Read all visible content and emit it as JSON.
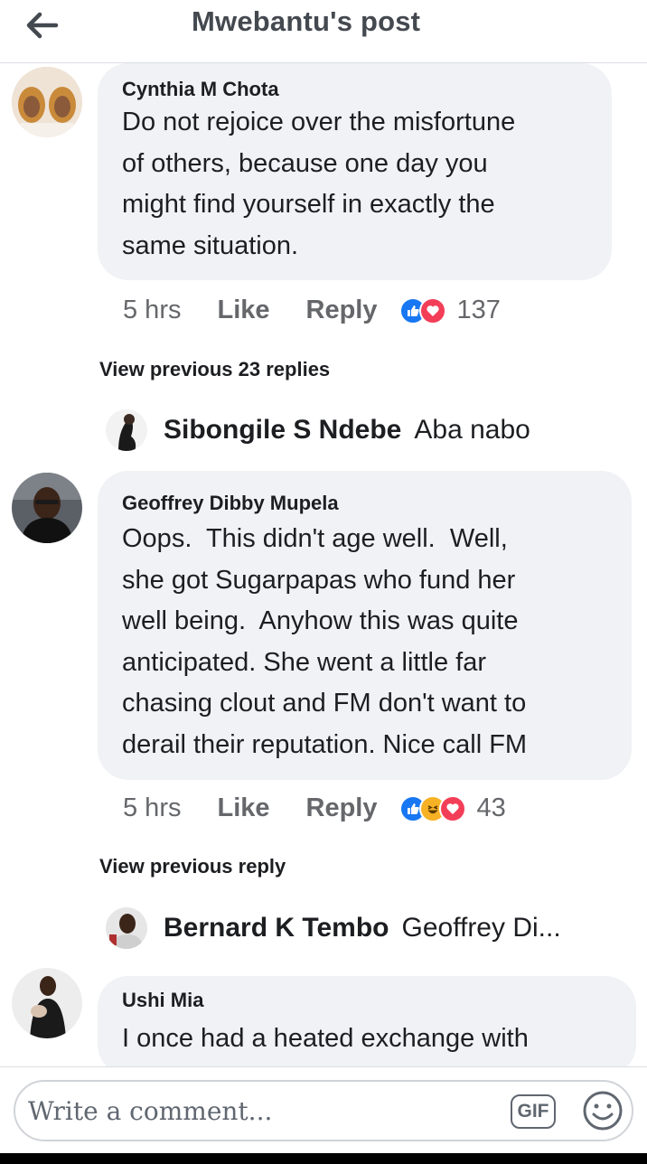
{
  "header": {
    "title": "Mwebantu's post"
  },
  "comments": [
    {
      "author": "Cynthia M Chota",
      "lines": [
        "Do not rejoice over the misfortune",
        "of others, because one day you",
        "might find yourself in exactly the",
        "same situation."
      ],
      "time": "5 hrs",
      "like": "Like",
      "reply": "Reply",
      "reaction_count": "137",
      "reactions": [
        "like",
        "love"
      ]
    },
    {
      "author": "Geoffrey Dibby Mupela",
      "lines": [
        "Oops.  This didn't age well.  Well,",
        "she got Sugarpapas who fund her",
        "well being.  Anyhow this was quite",
        "anticipated. She went a little far",
        "chasing clout and FM don't want to",
        "derail their reputation. Nice call FM"
      ],
      "time": "5 hrs",
      "like": "Like",
      "reply": "Reply",
      "reaction_count": "43",
      "reactions": [
        "like",
        "haha",
        "love"
      ]
    },
    {
      "author": "Ushi Mia",
      "lines": [
        "I once had a heated exchange with"
      ]
    }
  ],
  "view_previous_1": "View previous 23 replies",
  "reply_1": {
    "name": "Sibongile S Ndebe",
    "text": "Aba nabo"
  },
  "view_previous_2": "View previous reply",
  "reply_2": {
    "name": "Bernard K Tembo",
    "text": "Geoffrey Di..."
  },
  "composer": {
    "placeholder": "Write a comment...",
    "gif_label": "GIF"
  },
  "colors": {
    "like_blue": "#1877f2",
    "love_red": "#f33e58",
    "haha_yellow": "#f7b125",
    "bubble_gray": "#f0f2f5"
  }
}
